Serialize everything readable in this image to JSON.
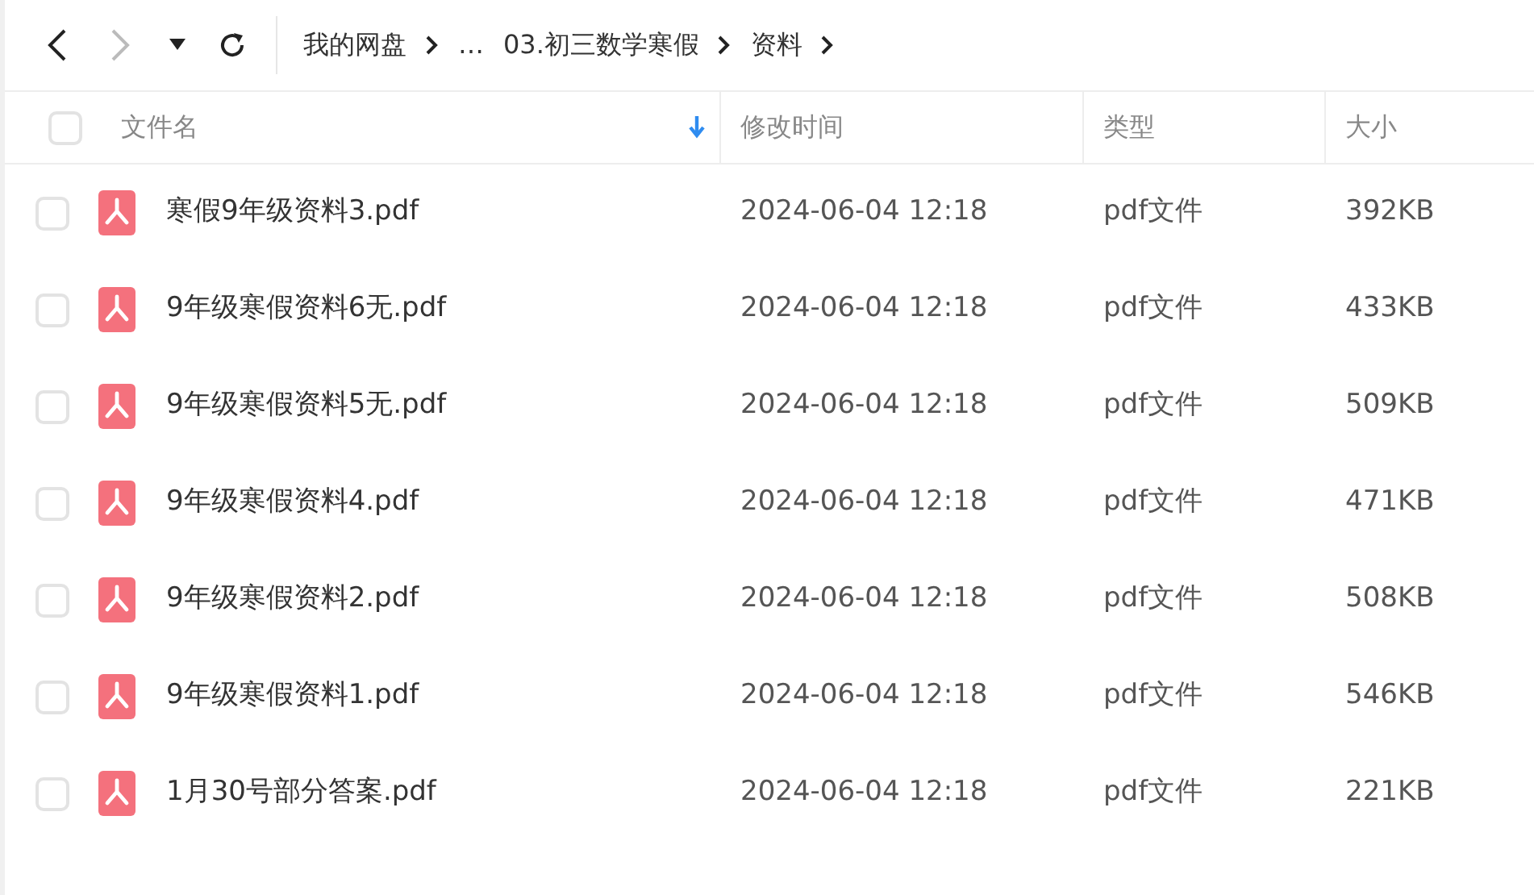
{
  "breadcrumb": [
    {
      "label": "我的网盘"
    },
    {
      "label": "…"
    },
    {
      "label": "03.初三数学寒假"
    },
    {
      "label": "资料"
    }
  ],
  "header": {
    "checked": false,
    "columns": [
      "文件名",
      "修改时间",
      "类型",
      "大小"
    ]
  },
  "rows": [
    {
      "name": "寒假9年级资料3.pdf",
      "modified": "2024-06-04 12:18",
      "type": "pdf文件",
      "size": "392KB",
      "checked": false
    },
    {
      "name": "9年级寒假资料6无.pdf",
      "modified": "2024-06-04 12:18",
      "type": "pdf文件",
      "size": "433KB",
      "checked": false
    },
    {
      "name": "9年级寒假资料5无.pdf",
      "modified": "2024-06-04 12:18",
      "type": "pdf文件",
      "size": "509KB",
      "checked": false
    },
    {
      "name": "9年级寒假资料4.pdf",
      "modified": "2024-06-04 12:18",
      "type": "pdf文件",
      "size": "471KB",
      "checked": false
    },
    {
      "name": "9年级寒假资料2.pdf",
      "modified": "2024-06-04 12:18",
      "type": "pdf文件",
      "size": "508KB",
      "checked": false
    },
    {
      "name": "9年级寒假资料1.pdf",
      "modified": "2024-06-04 12:18",
      "type": "pdf文件",
      "size": "546KB",
      "checked": false
    },
    {
      "name": "1月30号部分答案.pdf",
      "modified": "2024-06-04 12:18",
      "type": "pdf文件",
      "size": "221KB",
      "checked": false
    }
  ]
}
